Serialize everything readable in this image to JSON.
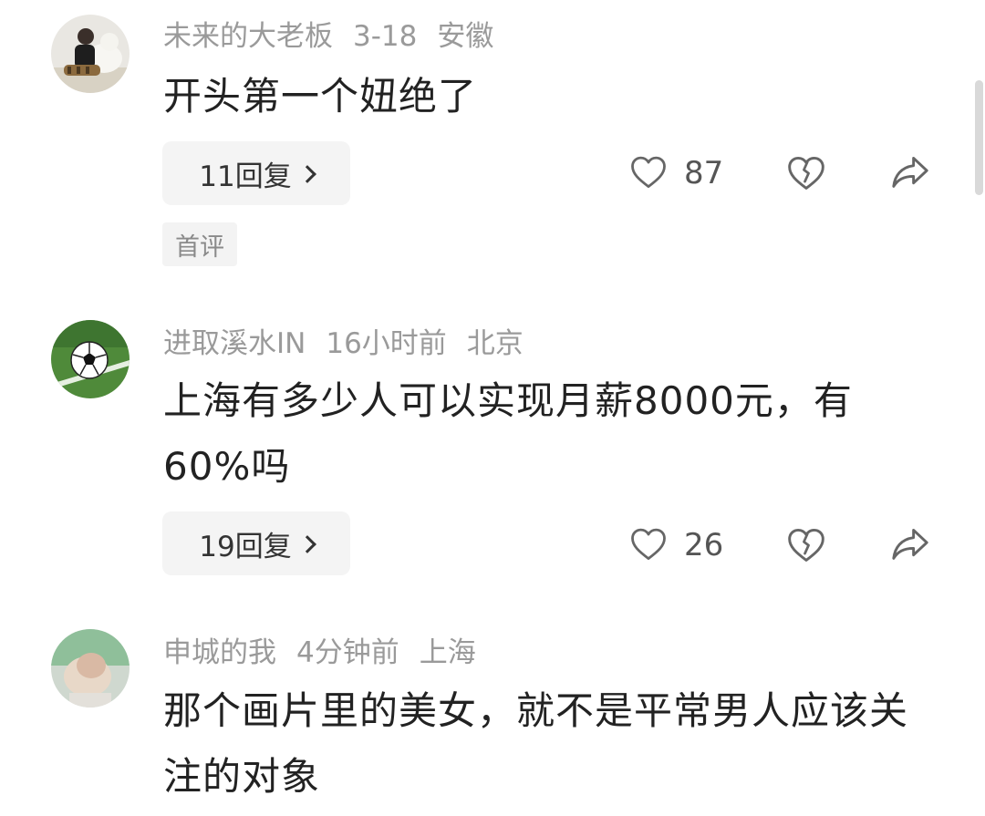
{
  "comments": [
    {
      "username": "未来的大老板",
      "date": "3-18",
      "location": "安徽",
      "text": "开头第一个妞绝了",
      "reply_label": "11回复",
      "likes": "87",
      "tag": "首评"
    },
    {
      "username": "进取溪水IN",
      "date": "16小时前",
      "location": "北京",
      "text": "上海有多少人可以实现月薪8000元，有60%吗",
      "reply_label": "19回复",
      "likes": "26"
    },
    {
      "username": "申城的我",
      "date": "4分钟前",
      "location": "上海",
      "text": "那个画片里的美女，就不是平常男人应该关注的对象"
    }
  ],
  "icons": {
    "like": "heart-outline-icon",
    "dislike": "broken-heart-icon",
    "share": "share-arrow-icon",
    "reply_chevron": "chevron-right-icon"
  },
  "colors": {
    "meta_text": "#9a9a9a",
    "body_text": "#222222",
    "button_bg": "#f4f4f4",
    "icon": "#666666"
  }
}
